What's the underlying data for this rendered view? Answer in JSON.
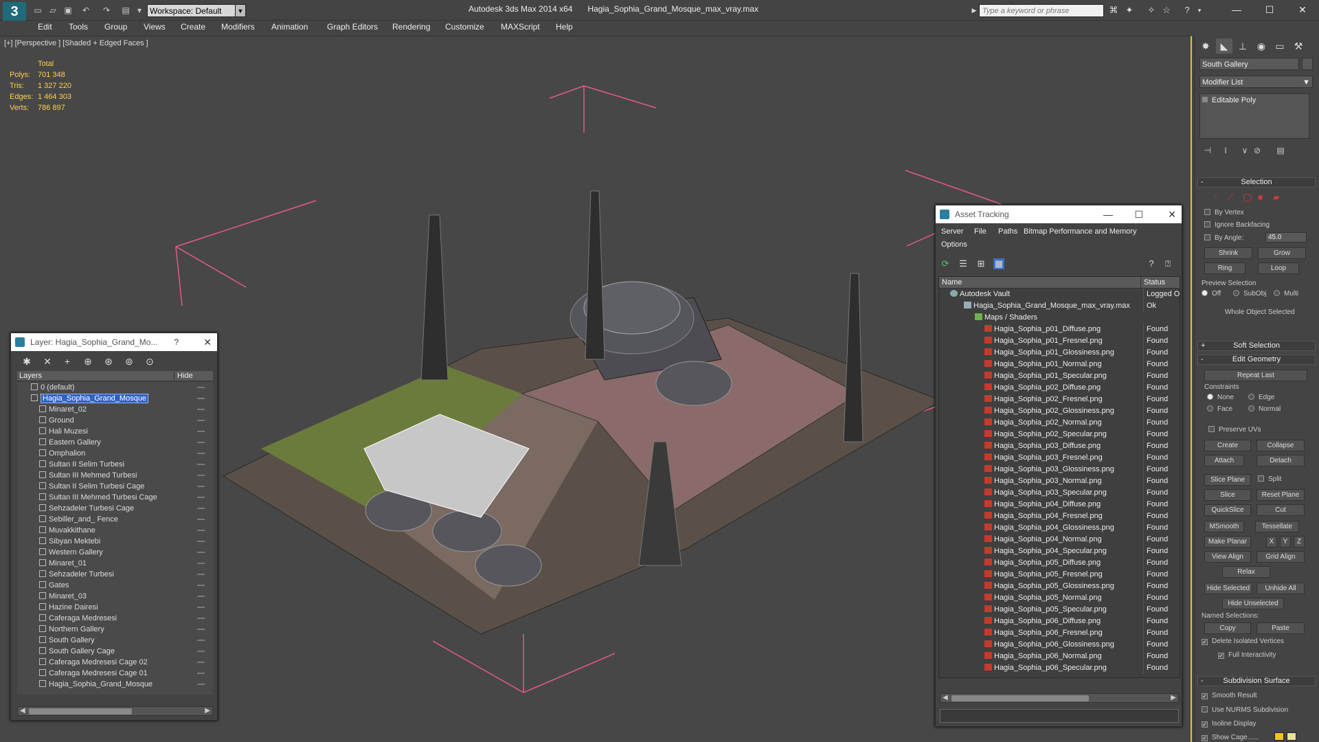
{
  "app": {
    "logo": "3",
    "workspace_label": "Workspace: Default",
    "product": "Autodesk 3ds Max  2014 x64",
    "filename": "Hagia_Sophia_Grand_Mosque_max_vray.max",
    "search_placeholder": "Type a keyword or phrase"
  },
  "menu": [
    "Edit",
    "Tools",
    "Group",
    "Views",
    "Create",
    "Modifiers",
    "Animation",
    "Graph Editors",
    "Rendering",
    "Customize",
    "MAXScript",
    "Help"
  ],
  "viewport": {
    "label": "[+] [Perspective ] [Shaded + Edged Faces ]",
    "stats": {
      "header": "Total",
      "rows": [
        {
          "k": "Polys:",
          "v": "701 348"
        },
        {
          "k": "Tris:",
          "v": "1 327 220"
        },
        {
          "k": "Edges:",
          "v": "1 464 303"
        },
        {
          "k": "Verts:",
          "v": "786 897"
        }
      ]
    }
  },
  "layer_panel": {
    "title": "Layer: Hagia_Sophia_Grand_Mo...",
    "help": "?",
    "col_layers": "Layers",
    "col_hide": "Hide",
    "rows": [
      {
        "name": "0 (default)",
        "indent": 1
      },
      {
        "name": "Hagia_Sophia_Grand_Mosque",
        "indent": 1,
        "selected": true
      },
      {
        "name": "Minaret_02",
        "indent": 2
      },
      {
        "name": "Ground",
        "indent": 2
      },
      {
        "name": "Hali Muzesi",
        "indent": 2
      },
      {
        "name": "Eastern Gallery",
        "indent": 2
      },
      {
        "name": "Omphalion",
        "indent": 2
      },
      {
        "name": "Sultan II Selim Turbesi",
        "indent": 2
      },
      {
        "name": "Sultan III Mehmed Turbesi",
        "indent": 2
      },
      {
        "name": "Sultan II Selim Turbesi Cage",
        "indent": 2
      },
      {
        "name": "Sultan III Mehmed Turbesi Cage",
        "indent": 2
      },
      {
        "name": "Sehzadeler Turbesi Cage",
        "indent": 2
      },
      {
        "name": "Sebiller_and_ Fence",
        "indent": 2
      },
      {
        "name": "Muvakkithane",
        "indent": 2
      },
      {
        "name": "Sibyan Mektebi",
        "indent": 2
      },
      {
        "name": "Western Gallery",
        "indent": 2
      },
      {
        "name": "Minaret_01",
        "indent": 2
      },
      {
        "name": "Sehzadeler Turbesi",
        "indent": 2
      },
      {
        "name": "Gates",
        "indent": 2
      },
      {
        "name": "Minaret_03",
        "indent": 2
      },
      {
        "name": "Hazine Dairesi",
        "indent": 2
      },
      {
        "name": "Caferaga Medresesi",
        "indent": 2
      },
      {
        "name": "Northern Gallery",
        "indent": 2
      },
      {
        "name": "South Gallery",
        "indent": 2
      },
      {
        "name": "South Gallery Cage",
        "indent": 2
      },
      {
        "name": "Caferaga Medresesi Cage 02",
        "indent": 2
      },
      {
        "name": "Caferaga Medresesi Cage 01",
        "indent": 2
      },
      {
        "name": "Hagia_Sophia_Grand_Mosque",
        "indent": 2
      }
    ]
  },
  "asset_panel": {
    "title": "Asset Tracking",
    "menu_row1": [
      "Server",
      "File",
      "Paths",
      "Bitmap Performance and Memory"
    ],
    "menu_row2": [
      "Options"
    ],
    "col_name": "Name",
    "col_status": "Status",
    "rows": [
      {
        "name": "Autodesk Vault",
        "status": "Logged O",
        "icon": "vault",
        "indent": 1
      },
      {
        "name": "Hagia_Sophia_Grand_Mosque_max_vray.max",
        "status": "Ok",
        "icon": "file",
        "indent": 2
      },
      {
        "name": "Maps / Shaders",
        "status": "",
        "icon": "folder",
        "indent": 3
      },
      {
        "name": "Hagia_Sophia_p01_Diffuse.png",
        "status": "Found",
        "icon": "png",
        "indent": 4
      },
      {
        "name": "Hagia_Sophia_p01_Fresnel.png",
        "status": "Found",
        "icon": "png",
        "indent": 4
      },
      {
        "name": "Hagia_Sophia_p01_Glossiness.png",
        "status": "Found",
        "icon": "png",
        "indent": 4
      },
      {
        "name": "Hagia_Sophia_p01_Normal.png",
        "status": "Found",
        "icon": "png",
        "indent": 4
      },
      {
        "name": "Hagia_Sophia_p01_Specular.png",
        "status": "Found",
        "icon": "png",
        "indent": 4
      },
      {
        "name": "Hagia_Sophia_p02_Diffuse.png",
        "status": "Found",
        "icon": "png",
        "indent": 4
      },
      {
        "name": "Hagia_Sophia_p02_Fresnel.png",
        "status": "Found",
        "icon": "png",
        "indent": 4
      },
      {
        "name": "Hagia_Sophia_p02_Glossiness.png",
        "status": "Found",
        "icon": "png",
        "indent": 4
      },
      {
        "name": "Hagia_Sophia_p02_Normal.png",
        "status": "Found",
        "icon": "png",
        "indent": 4
      },
      {
        "name": "Hagia_Sophia_p02_Specular.png",
        "status": "Found",
        "icon": "png",
        "indent": 4
      },
      {
        "name": "Hagia_Sophia_p03_Diffuse.png",
        "status": "Found",
        "icon": "png",
        "indent": 4
      },
      {
        "name": "Hagia_Sophia_p03_Fresnel.png",
        "status": "Found",
        "icon": "png",
        "indent": 4
      },
      {
        "name": "Hagia_Sophia_p03_Glossiness.png",
        "status": "Found",
        "icon": "png",
        "indent": 4
      },
      {
        "name": "Hagia_Sophia_p03_Normal.png",
        "status": "Found",
        "icon": "png",
        "indent": 4
      },
      {
        "name": "Hagia_Sophia_p03_Specular.png",
        "status": "Found",
        "icon": "png",
        "indent": 4
      },
      {
        "name": "Hagia_Sophia_p04_Diffuse.png",
        "status": "Found",
        "icon": "png",
        "indent": 4
      },
      {
        "name": "Hagia_Sophia_p04_Fresnel.png",
        "status": "Found",
        "icon": "png",
        "indent": 4
      },
      {
        "name": "Hagia_Sophia_p04_Glossiness.png",
        "status": "Found",
        "icon": "png",
        "indent": 4
      },
      {
        "name": "Hagia_Sophia_p04_Normal.png",
        "status": "Found",
        "icon": "png",
        "indent": 4
      },
      {
        "name": "Hagia_Sophia_p04_Specular.png",
        "status": "Found",
        "icon": "png",
        "indent": 4
      },
      {
        "name": "Hagia_Sophia_p05_Diffuse.png",
        "status": "Found",
        "icon": "png",
        "indent": 4
      },
      {
        "name": "Hagia_Sophia_p05_Fresnel.png",
        "status": "Found",
        "icon": "png",
        "indent": 4
      },
      {
        "name": "Hagia_Sophia_p05_Glossiness.png",
        "status": "Found",
        "icon": "png",
        "indent": 4
      },
      {
        "name": "Hagia_Sophia_p05_Normal.png",
        "status": "Found",
        "icon": "png",
        "indent": 4
      },
      {
        "name": "Hagia_Sophia_p05_Specular.png",
        "status": "Found",
        "icon": "png",
        "indent": 4
      },
      {
        "name": "Hagia_Sophia_p06_Diffuse.png",
        "status": "Found",
        "icon": "png",
        "indent": 4
      },
      {
        "name": "Hagia_Sophia_p06_Fresnel.png",
        "status": "Found",
        "icon": "png",
        "indent": 4
      },
      {
        "name": "Hagia_Sophia_p06_Glossiness.png",
        "status": "Found",
        "icon": "png",
        "indent": 4
      },
      {
        "name": "Hagia_Sophia_p06_Normal.png",
        "status": "Found",
        "icon": "png",
        "indent": 4
      },
      {
        "name": "Hagia_Sophia_p06_Specular.png",
        "status": "Found",
        "icon": "png",
        "indent": 4
      }
    ]
  },
  "cmd_panel": {
    "object_name": "South Gallery",
    "modifier_list": "Modifier List",
    "stack_item": "Editable Poly",
    "selection": {
      "title": "Selection",
      "by_vertex": "By Vertex",
      "ignore_backfacing": "Ignore Backfacing",
      "by_angle": "By Angle:",
      "angle_value": "45.0",
      "shrink": "Shrink",
      "grow": "Grow",
      "ring": "Ring",
      "loop": "Loop",
      "preview": "Preview Selection",
      "off": "Off",
      "subobj": "SubObj",
      "multi": "Multi",
      "status": "Whole Object Selected"
    },
    "soft_selection": "Soft Selection",
    "edit_geometry": {
      "title": "Edit Geometry",
      "repeat_last": "Repeat Last",
      "constraints": "Constraints",
      "none": "None",
      "edge": "Edge",
      "face": "Face",
      "normal": "Normal",
      "preserve_uvs": "Preserve UVs",
      "create": "Create",
      "collapse": "Collapse",
      "attach": "Attach",
      "detach": "Detach",
      "slice_plane": "Slice Plane",
      "split": "Split",
      "slice": "Slice",
      "reset_plane": "Reset Plane",
      "quickslice": "QuickSlice",
      "cut": "Cut",
      "msmooth": "MSmooth",
      "tessellate": "Tessellate",
      "make_planar": "Make Planar",
      "x": "X",
      "y": "Y",
      "z": "Z",
      "view_align": "View Align",
      "grid_align": "Grid Align",
      "relax": "Relax",
      "hide_selected": "Hide Selected",
      "unhide_all": "Unhide All",
      "hide_unselected": "Hide Unselected",
      "named_selections": "Named Selections:",
      "copy": "Copy",
      "paste": "Paste",
      "delete_isolated": "Delete Isolated Vertices",
      "full_interactivity": "Full Interactivity"
    },
    "subdivision": {
      "title": "Subdivision Surface",
      "smooth_result": "Smooth Result",
      "use_nurms": "Use NURMS Subdivision",
      "isoline": "Isoline Display",
      "show_cage": "Show Cage......"
    }
  },
  "colors": {
    "accent": "#e5c22b",
    "selection": "#2f62c9",
    "stats": "#ffd24a",
    "bbox": "#e55a8a"
  }
}
